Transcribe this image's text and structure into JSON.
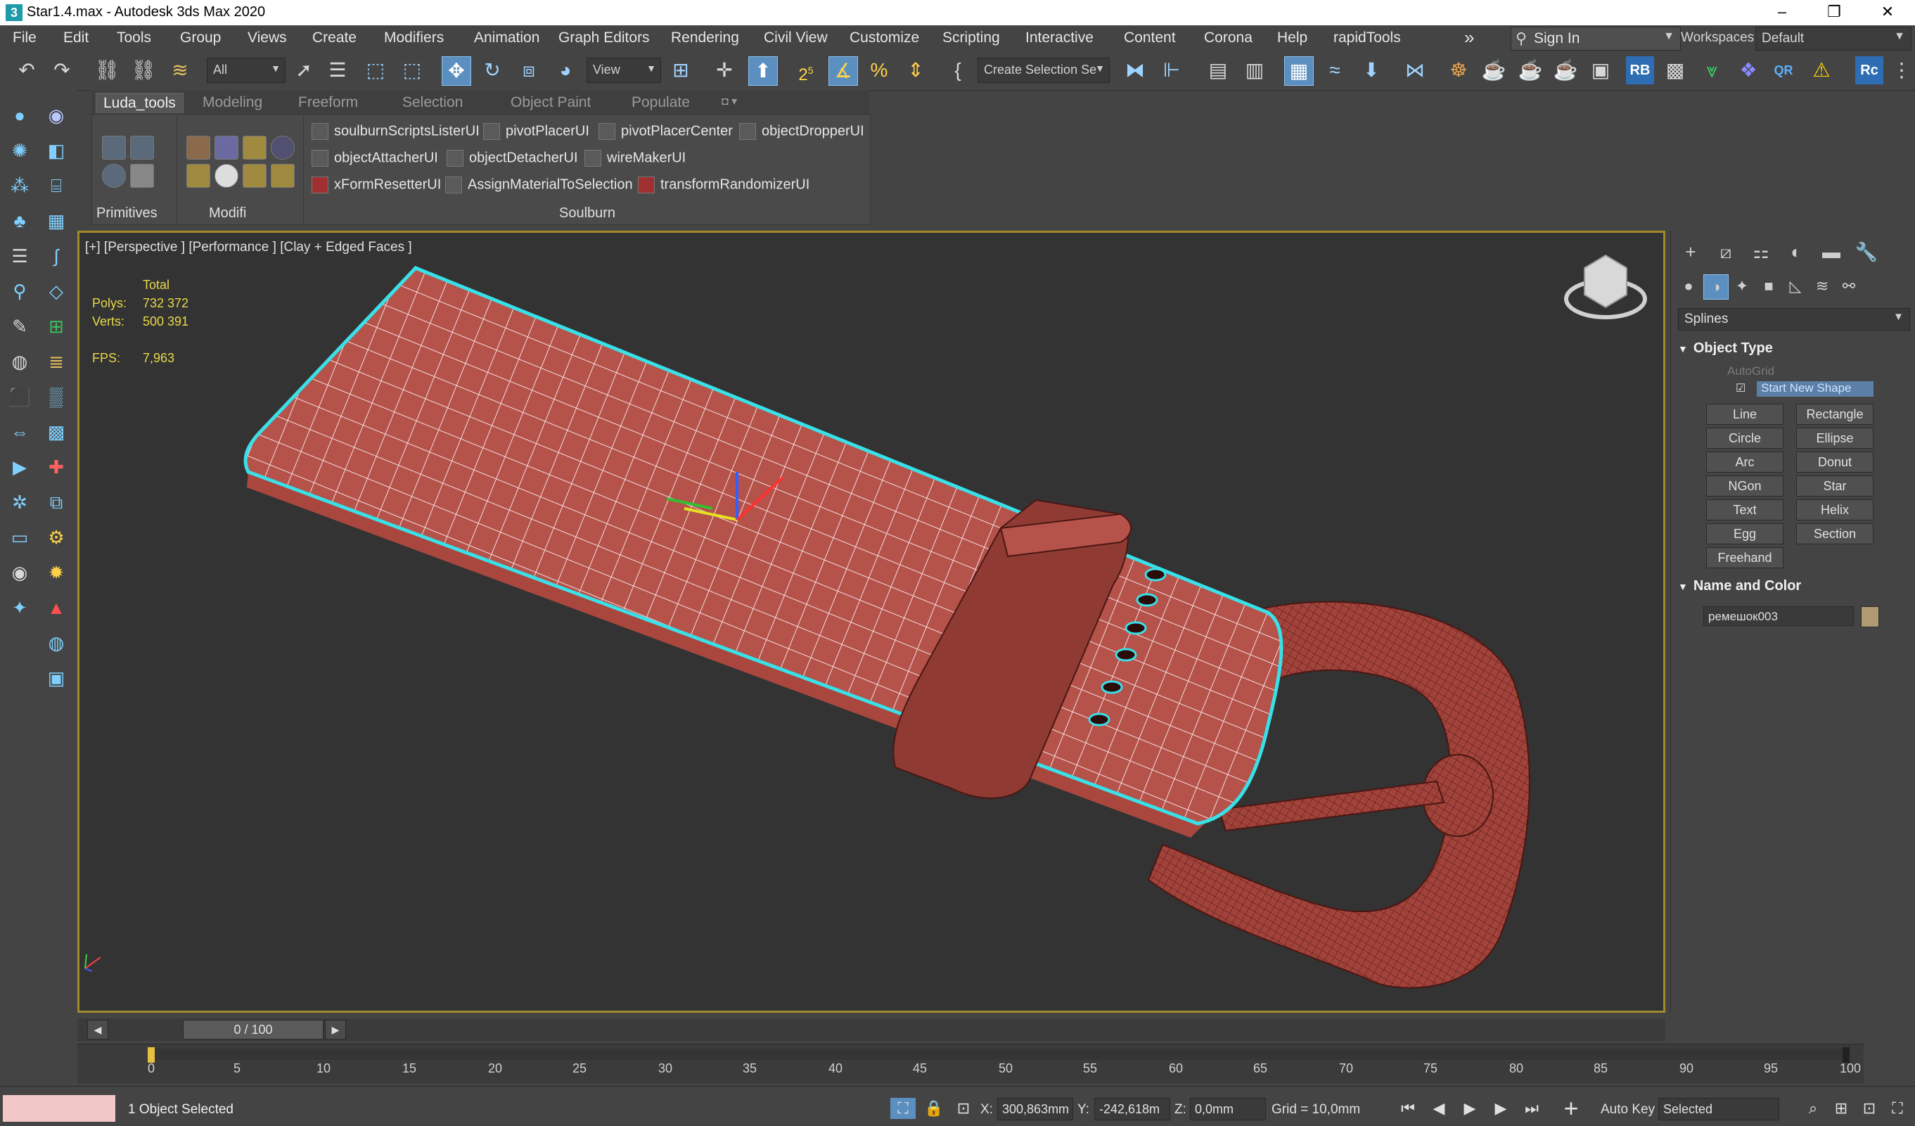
{
  "window": {
    "title": "Star1.4.max - Autodesk 3ds Max 2020",
    "app_icon": "3"
  },
  "menu": [
    "File",
    "Edit",
    "Tools",
    "Group",
    "Views",
    "Create",
    "Modifiers",
    "Animation",
    "Graph Editors",
    "Rendering",
    "Civil View",
    "Customize",
    "Scripting",
    "Interactive",
    "Content",
    "Corona",
    "Help",
    "rapidTools"
  ],
  "menu_more": "»",
  "signin": {
    "label": "Sign In"
  },
  "workspaces": {
    "label": "Workspaces:",
    "value": "Default"
  },
  "toolbar": {
    "selection_filter": "All",
    "ref_coord": "View",
    "named_selection": "Create Selection Se",
    "snap_label": "2",
    "snap_suffix": "5",
    "rb": "RB",
    "qr": "QR",
    "rc": "Rc"
  },
  "ribbon": {
    "tabs": [
      "Luda_tools",
      "Modeling",
      "Freeform",
      "Selection",
      "Object Paint",
      "Populate"
    ],
    "active_tab": "Luda_tools",
    "groups": [
      "Primitives",
      "Modifi",
      "Soulburn"
    ],
    "scripts": [
      [
        "soulburnScriptsListerUI",
        "pivotPlacerUI",
        "pivotPlacerCenter",
        "objectDropperUI"
      ],
      [
        "objectAttacherUI",
        "objectDetacherUI",
        "wireMakerUI"
      ],
      [
        "xFormResetterUI",
        "AssignMaterialToSelection",
        "transformRandomizerUI"
      ]
    ]
  },
  "viewport": {
    "label": "[+] [Perspective ] [Performance ] [Clay + Edged Faces ]",
    "stats": {
      "total_label": "Total",
      "polys_label": "Polys:",
      "polys": "732 372",
      "verts_label": "Verts:",
      "verts": "500 391",
      "fps_label": "FPS:",
      "fps": "7,963"
    }
  },
  "command_panel": {
    "category": "Splines",
    "object_type": {
      "title": "Object Type",
      "autogrid": "AutoGrid",
      "start_new_shape": "Start New Shape",
      "buttons": [
        "Line",
        "Rectangle",
        "Circle",
        "Ellipse",
        "Arc",
        "Donut",
        "NGon",
        "Star",
        "Text",
        "Helix",
        "Egg",
        "Section",
        "Freehand"
      ]
    },
    "name_and_color": {
      "title": "Name and Color",
      "name": "ремешок003",
      "color": "#b09a72"
    }
  },
  "timeline": {
    "frame": "0 / 100",
    "ticks": [
      "0",
      "5",
      "10",
      "15",
      "20",
      "25",
      "30",
      "35",
      "40",
      "45",
      "50",
      "55",
      "60",
      "65",
      "70",
      "75",
      "80",
      "85",
      "90",
      "95",
      "100"
    ]
  },
  "status": {
    "message": "1 Object Selected",
    "x_label": "X:",
    "x": "300,863mm",
    "y_label": "Y:",
    "y": "-242,618m",
    "z_label": "Z:",
    "z": "0,0mm",
    "grid": "Grid = 10,0mm",
    "auto_key": "Auto Key",
    "key_filter": "Selected"
  },
  "colors": {
    "model": "#b04a40",
    "selection_outline": "#39e0e8",
    "viewport_border": "#a08a2a"
  }
}
